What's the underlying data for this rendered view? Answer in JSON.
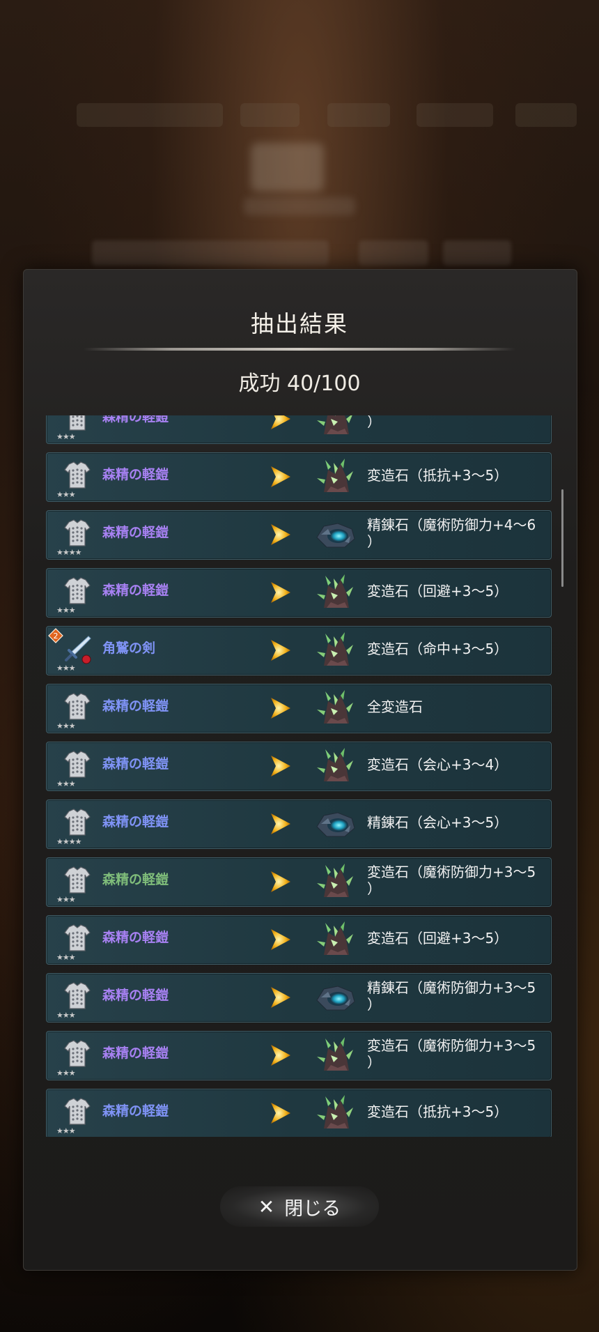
{
  "header": {
    "title": "抽出結果",
    "success_label": "成功",
    "success_count": "40/100"
  },
  "rows": [
    {
      "name": "森精の軽鎧",
      "rarity": "★★★",
      "name_color": "#a781f2",
      "result": "変造石（抵抗+3～5）",
      "stone": "green"
    },
    {
      "name": "森精の軽鎧",
      "rarity": "★★★★",
      "name_color": "#a781f2",
      "result": "精錬石（魔術防御力+4～6\n）",
      "stone": "blue"
    },
    {
      "name": "森精の軽鎧",
      "rarity": "★★★",
      "name_color": "#a781f2",
      "result": "変造石（回避+3～5）",
      "stone": "green"
    },
    {
      "name": "角鷲の剣",
      "rarity": "★★★",
      "name_color": "#7f93f5",
      "result": "変造石（命中+3～5）",
      "stone": "green",
      "badge": "2"
    },
    {
      "name": "森精の軽鎧",
      "rarity": "★★★",
      "name_color": "#7f93f5",
      "result": "全変造石",
      "stone": "green"
    },
    {
      "name": "森精の軽鎧",
      "rarity": "★★★",
      "name_color": "#7f93f5",
      "result": "変造石（会心+3～4）",
      "stone": "green"
    },
    {
      "name": "森精の軽鎧",
      "rarity": "★★★★",
      "name_color": "#7f93f5",
      "result": "精錬石（会心+3～5）",
      "stone": "blue"
    },
    {
      "name": "森精の軽鎧",
      "rarity": "★★★",
      "name_color": "#7fbd7a",
      "result": "変造石（魔術防御力+3～5\n）",
      "stone": "green"
    },
    {
      "name": "森精の軽鎧",
      "rarity": "★★★",
      "name_color": "#a781f2",
      "result": "変造石（回避+3～5）",
      "stone": "green"
    },
    {
      "name": "森精の軽鎧",
      "rarity": "★★★",
      "name_color": "#a781f2",
      "result": "精錬石（魔術防御力+3～5\n）",
      "stone": "blue"
    },
    {
      "name": "森精の軽鎧",
      "rarity": "★★★",
      "name_color": "#a781f2",
      "result": "変造石（魔術防御力+3～5\n）",
      "stone": "green"
    },
    {
      "name": "森精の軽鎧",
      "rarity": "★★★",
      "name_color": "#7f93f5",
      "result": "変造石（抵抗+3～5）",
      "stone": "green"
    }
  ],
  "partial_row": {
    "name": "森精の軽鎧",
    "rarity": "★★★",
    "name_color": "#a781f2",
    "result": "）"
  },
  "footer": {
    "close_label": "閉じる"
  }
}
